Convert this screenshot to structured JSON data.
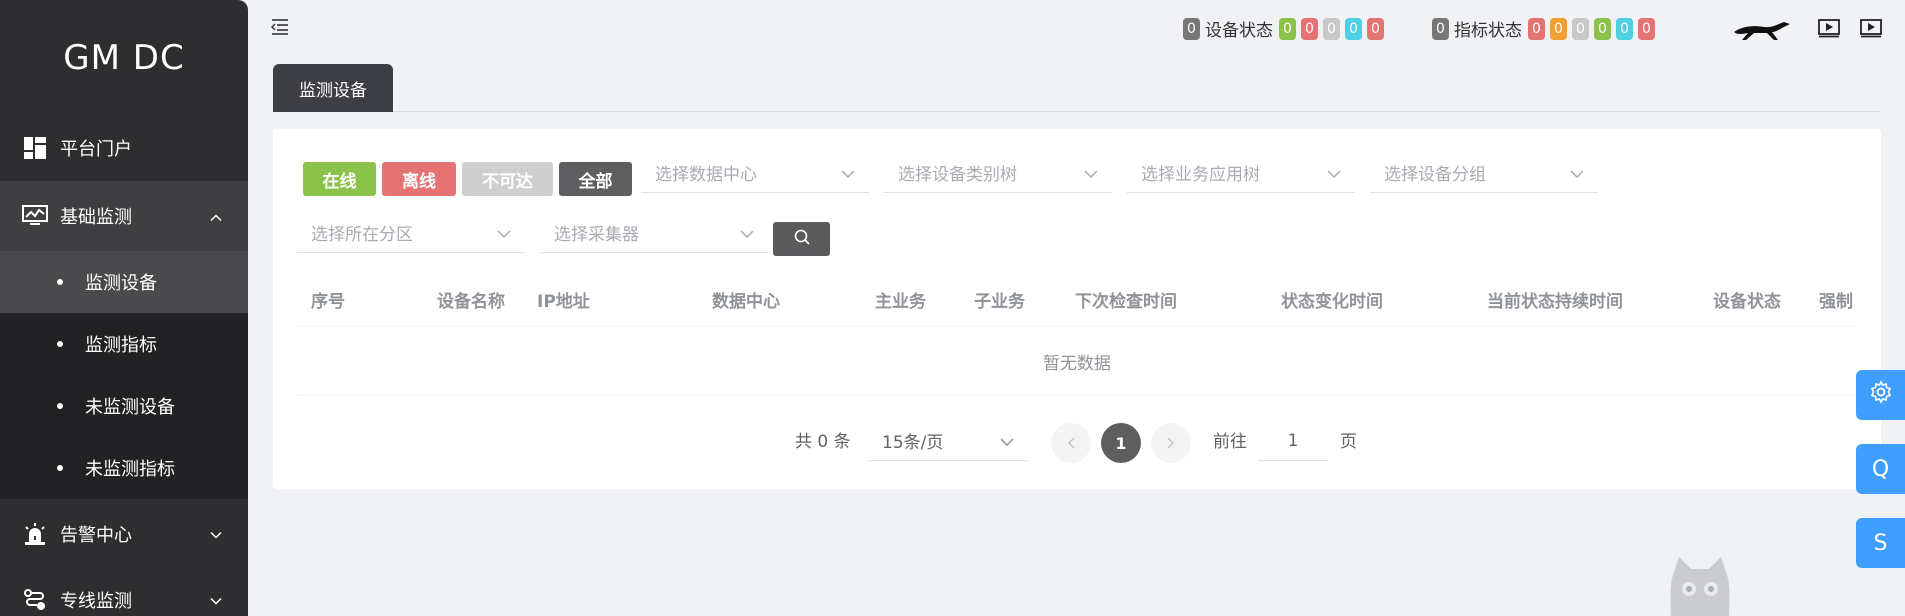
{
  "sidebar": {
    "brand": "GM DC",
    "items": [
      {
        "label": "平台门户",
        "icon": "dashboard-icon"
      },
      {
        "label": "基础监测",
        "icon": "monitor-chart-icon",
        "expanded": true
      },
      {
        "label": "告警中心",
        "icon": "alarm-icon"
      },
      {
        "label": "专线监测",
        "icon": "route-icon"
      }
    ],
    "submenu": [
      {
        "label": "监测设备",
        "active": true
      },
      {
        "label": "监测指标"
      },
      {
        "label": "未监测设备"
      },
      {
        "label": "未监测指标"
      }
    ]
  },
  "header": {
    "device_status": {
      "total": "0",
      "label": "设备状态",
      "counts": [
        {
          "value": "0",
          "color": "#8bc34a"
        },
        {
          "value": "0",
          "color": "#e57373"
        },
        {
          "value": "0",
          "color": "#c8c8c8"
        },
        {
          "value": "0",
          "color": "#4dd0e1"
        },
        {
          "value": "0",
          "color": "#e57373"
        }
      ]
    },
    "metric_status": {
      "total": "0",
      "label": "指标状态",
      "counts": [
        {
          "value": "0",
          "color": "#e57373"
        },
        {
          "value": "0",
          "color": "#f0a030"
        },
        {
          "value": "0",
          "color": "#c8c8c8"
        },
        {
          "value": "0",
          "color": "#8bc34a"
        },
        {
          "value": "0",
          "color": "#4dd0e1"
        },
        {
          "value": "0",
          "color": "#e57373"
        }
      ]
    }
  },
  "tabs": [
    {
      "label": "监测设备"
    }
  ],
  "filters": {
    "buttons": [
      {
        "label": "在线",
        "color": "#8bc34a"
      },
      {
        "label": "离线",
        "color": "#e57373"
      },
      {
        "label": "不可达",
        "color": "#cfcfcf"
      },
      {
        "label": "全部",
        "color": "#5e5e60"
      }
    ],
    "selects": [
      {
        "placeholder": "选择数据中心"
      },
      {
        "placeholder": "选择设备类别树"
      },
      {
        "placeholder": "选择业务应用树"
      },
      {
        "placeholder": "选择设备分组"
      },
      {
        "placeholder": "选择所在分区"
      },
      {
        "placeholder": "选择采集器"
      }
    ]
  },
  "table": {
    "columns": [
      "序号",
      "设备名称",
      "IP地址",
      "数据中心",
      "主业务",
      "子业务",
      "下次检查时间",
      "状态变化时间",
      "当前状态持续时间",
      "设备状态",
      "强制"
    ],
    "empty_text": "暂无数据"
  },
  "pagination": {
    "total_text": "共 0 条",
    "page_size": "15条/页",
    "current_page": "1",
    "goto_label": "前往",
    "goto_value": "1",
    "page_unit": "页"
  },
  "float_buttons": [
    {
      "label": "",
      "icon": "gear-icon"
    },
    {
      "label": "Q"
    },
    {
      "label": "S"
    }
  ],
  "colors": {
    "accent": "#409eff",
    "sidebar": "#2e2e30"
  }
}
